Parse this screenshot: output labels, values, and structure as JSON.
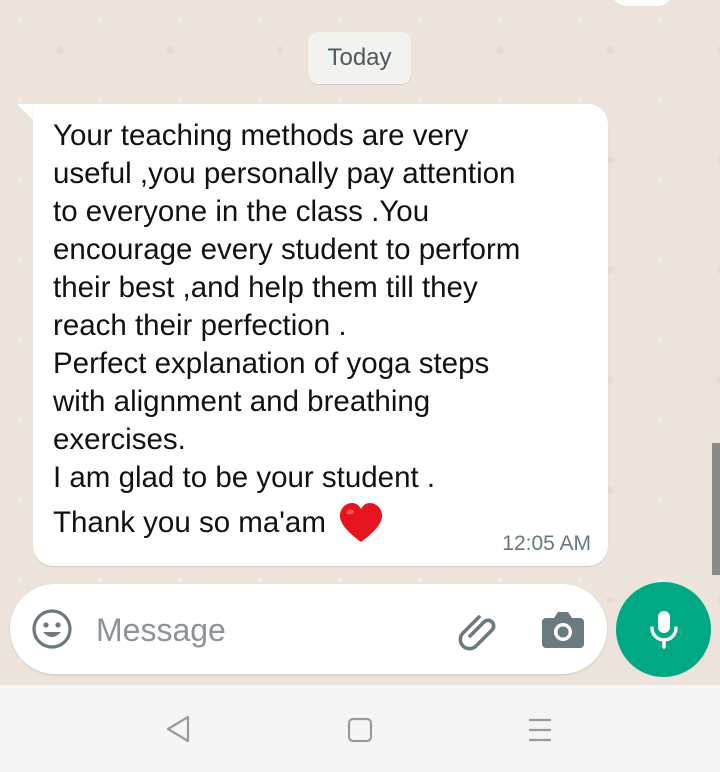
{
  "date_chip": "Today",
  "message": {
    "body": "Your teaching methods are very\nuseful ,you personally pay attention\nto everyone in the class .You\nencourage every student to perform\ntheir best ,and help them till they\nreach their perfection .\nPerfect explanation of yoga steps\nwith alignment and breathing\nexercises.\nI am glad to be your student .",
    "last_line": "Thank you so ma'am",
    "emoji": "red-heart",
    "time": "12:05 AM"
  },
  "composer": {
    "placeholder": "Message"
  },
  "colors": {
    "accent": "#00a884",
    "chat_bg": "#ece4db",
    "bubble": "#ffffff",
    "heart": "#e5141e"
  },
  "icons": {
    "emoji": "smiley-icon",
    "attach": "paperclip-icon",
    "camera": "camera-icon",
    "mic": "microphone-icon",
    "back": "nav-back-icon",
    "home": "nav-home-icon",
    "recents": "nav-menu-icon"
  }
}
